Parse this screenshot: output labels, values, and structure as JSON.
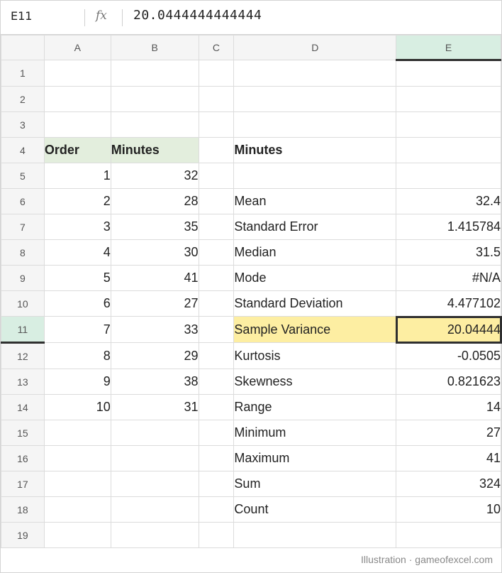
{
  "formula_bar": {
    "name_box": "E11",
    "fx_label": "fx",
    "formula": "20.0444444444444"
  },
  "columns": [
    "A",
    "B",
    "C",
    "D",
    "E"
  ],
  "active_column": "E",
  "active_row": "11",
  "rows": [
    {
      "n": "1",
      "a": "",
      "b": "",
      "d": "",
      "e": ""
    },
    {
      "n": "2",
      "a": "",
      "b": "",
      "d": "",
      "e": ""
    },
    {
      "n": "3",
      "a": "",
      "b": "",
      "d": "",
      "e": ""
    },
    {
      "n": "4",
      "a": "Order",
      "b": "Minutes",
      "d": "Minutes",
      "e": ""
    },
    {
      "n": "5",
      "a": "1",
      "b": "32",
      "d": "",
      "e": ""
    },
    {
      "n": "6",
      "a": "2",
      "b": "28",
      "d": "Mean",
      "e": "32.4"
    },
    {
      "n": "7",
      "a": "3",
      "b": "35",
      "d": "Standard Error",
      "e": "1.415784"
    },
    {
      "n": "8",
      "a": "4",
      "b": "30",
      "d": "Median",
      "e": "31.5"
    },
    {
      "n": "9",
      "a": "5",
      "b": "41",
      "d": "Mode",
      "e": "#N/A"
    },
    {
      "n": "10",
      "a": "6",
      "b": "27",
      "d": "Standard Deviation",
      "e": "4.477102"
    },
    {
      "n": "11",
      "a": "7",
      "b": "33",
      "d": "Sample Variance",
      "e": "20.04444"
    },
    {
      "n": "12",
      "a": "8",
      "b": "29",
      "d": "Kurtosis",
      "e": "-0.0505"
    },
    {
      "n": "13",
      "a": "9",
      "b": "38",
      "d": "Skewness",
      "e": "0.821623"
    },
    {
      "n": "14",
      "a": "10",
      "b": "31",
      "d": "Range",
      "e": "14"
    },
    {
      "n": "15",
      "a": "",
      "b": "",
      "d": "Minimum",
      "e": "27"
    },
    {
      "n": "16",
      "a": "",
      "b": "",
      "d": "Maximum",
      "e": "41"
    },
    {
      "n": "17",
      "a": "",
      "b": "",
      "d": "Sum",
      "e": "324"
    },
    {
      "n": "18",
      "a": "",
      "b": "",
      "d": "Count",
      "e": "10"
    },
    {
      "n": "19",
      "a": "",
      "b": "",
      "d": "",
      "e": ""
    }
  ],
  "colors": {
    "header_fill": "#e3eedd",
    "highlight_fill": "#fdeea2",
    "active_header": "#d8eee2"
  },
  "footer": "Illustration · gameofexcel.com"
}
